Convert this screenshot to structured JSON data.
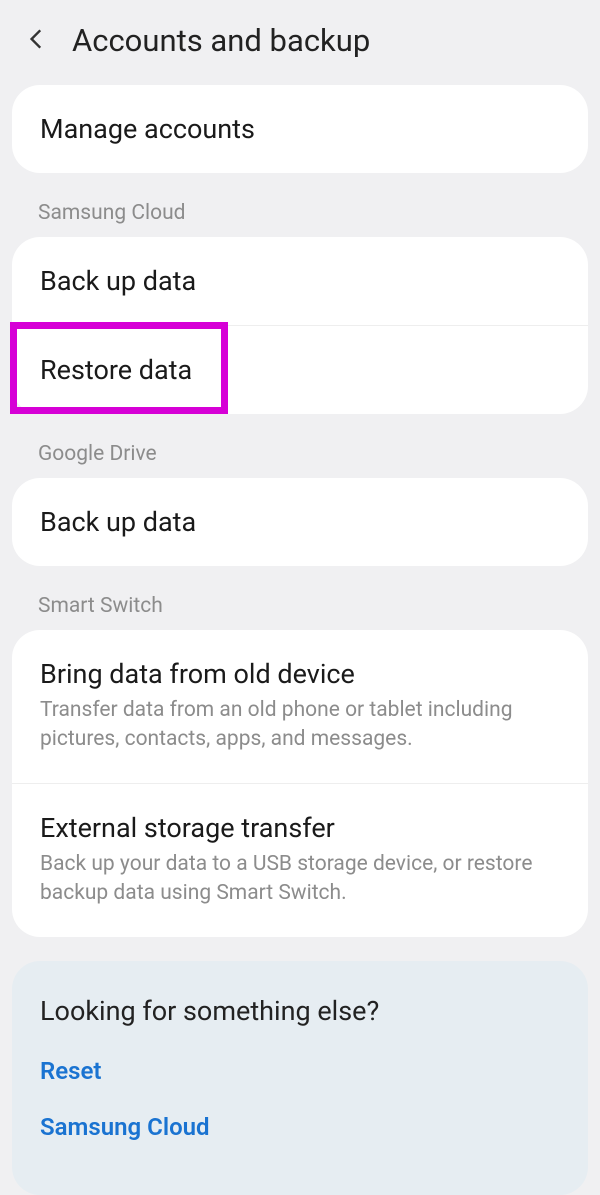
{
  "header": {
    "title": "Accounts and backup"
  },
  "sections": {
    "manage": {
      "title": "Manage accounts"
    },
    "samsung_cloud": {
      "header": "Samsung Cloud",
      "backup": "Back up data",
      "restore": "Restore data"
    },
    "google_drive": {
      "header": "Google Drive",
      "backup": "Back up data"
    },
    "smart_switch": {
      "header": "Smart Switch",
      "bring": {
        "title": "Bring data from old device",
        "desc": "Transfer data from an old phone or tablet including pictures, contacts, apps, and messages."
      },
      "external": {
        "title": "External storage transfer",
        "desc": "Back up your data to a USB storage device, or restore backup data using Smart Switch."
      }
    }
  },
  "footer": {
    "title": "Looking for something else?",
    "reset": "Reset",
    "samsung_cloud": "Samsung Cloud"
  },
  "annotation": {
    "highlight_target": "restore-data"
  }
}
